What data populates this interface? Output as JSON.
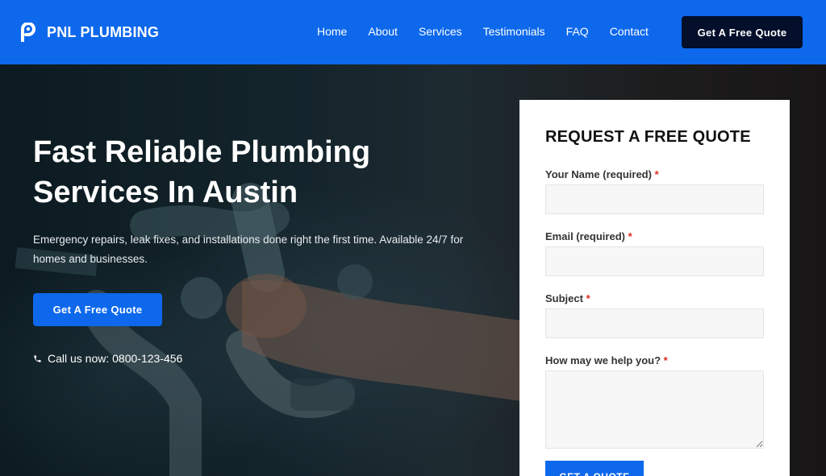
{
  "header": {
    "logo_text": "PNL PLUMBING",
    "nav": [
      "Home",
      "About",
      "Services",
      "Testimonials",
      "FAQ",
      "Contact"
    ],
    "cta_label": "Get A Free Quote"
  },
  "hero": {
    "title_line1": "Fast Reliable Plumbing",
    "title_line2": "Services In Austin",
    "subtitle": "Emergency repairs, leak fixes, and installations done right the first time. Available 24/7 for homes and businesses.",
    "cta_label": "Get A Free Quote",
    "call_text": "Call us now: 0800-123-456"
  },
  "form": {
    "title": "REQUEST A FREE QUOTE",
    "fields": [
      {
        "label": "Your Name (required)",
        "required_mark": "*"
      },
      {
        "label": "Email (required)",
        "required_mark": "*"
      },
      {
        "label": "Subject",
        "required_mark": "*"
      },
      {
        "label": "How may we help you?",
        "required_mark": "*"
      }
    ],
    "submit_label": "GET A QUOTE"
  },
  "colors": {
    "brand_blue": "#0d68ec",
    "dark_navy": "#030f2b",
    "required_red": "#e02b20"
  }
}
